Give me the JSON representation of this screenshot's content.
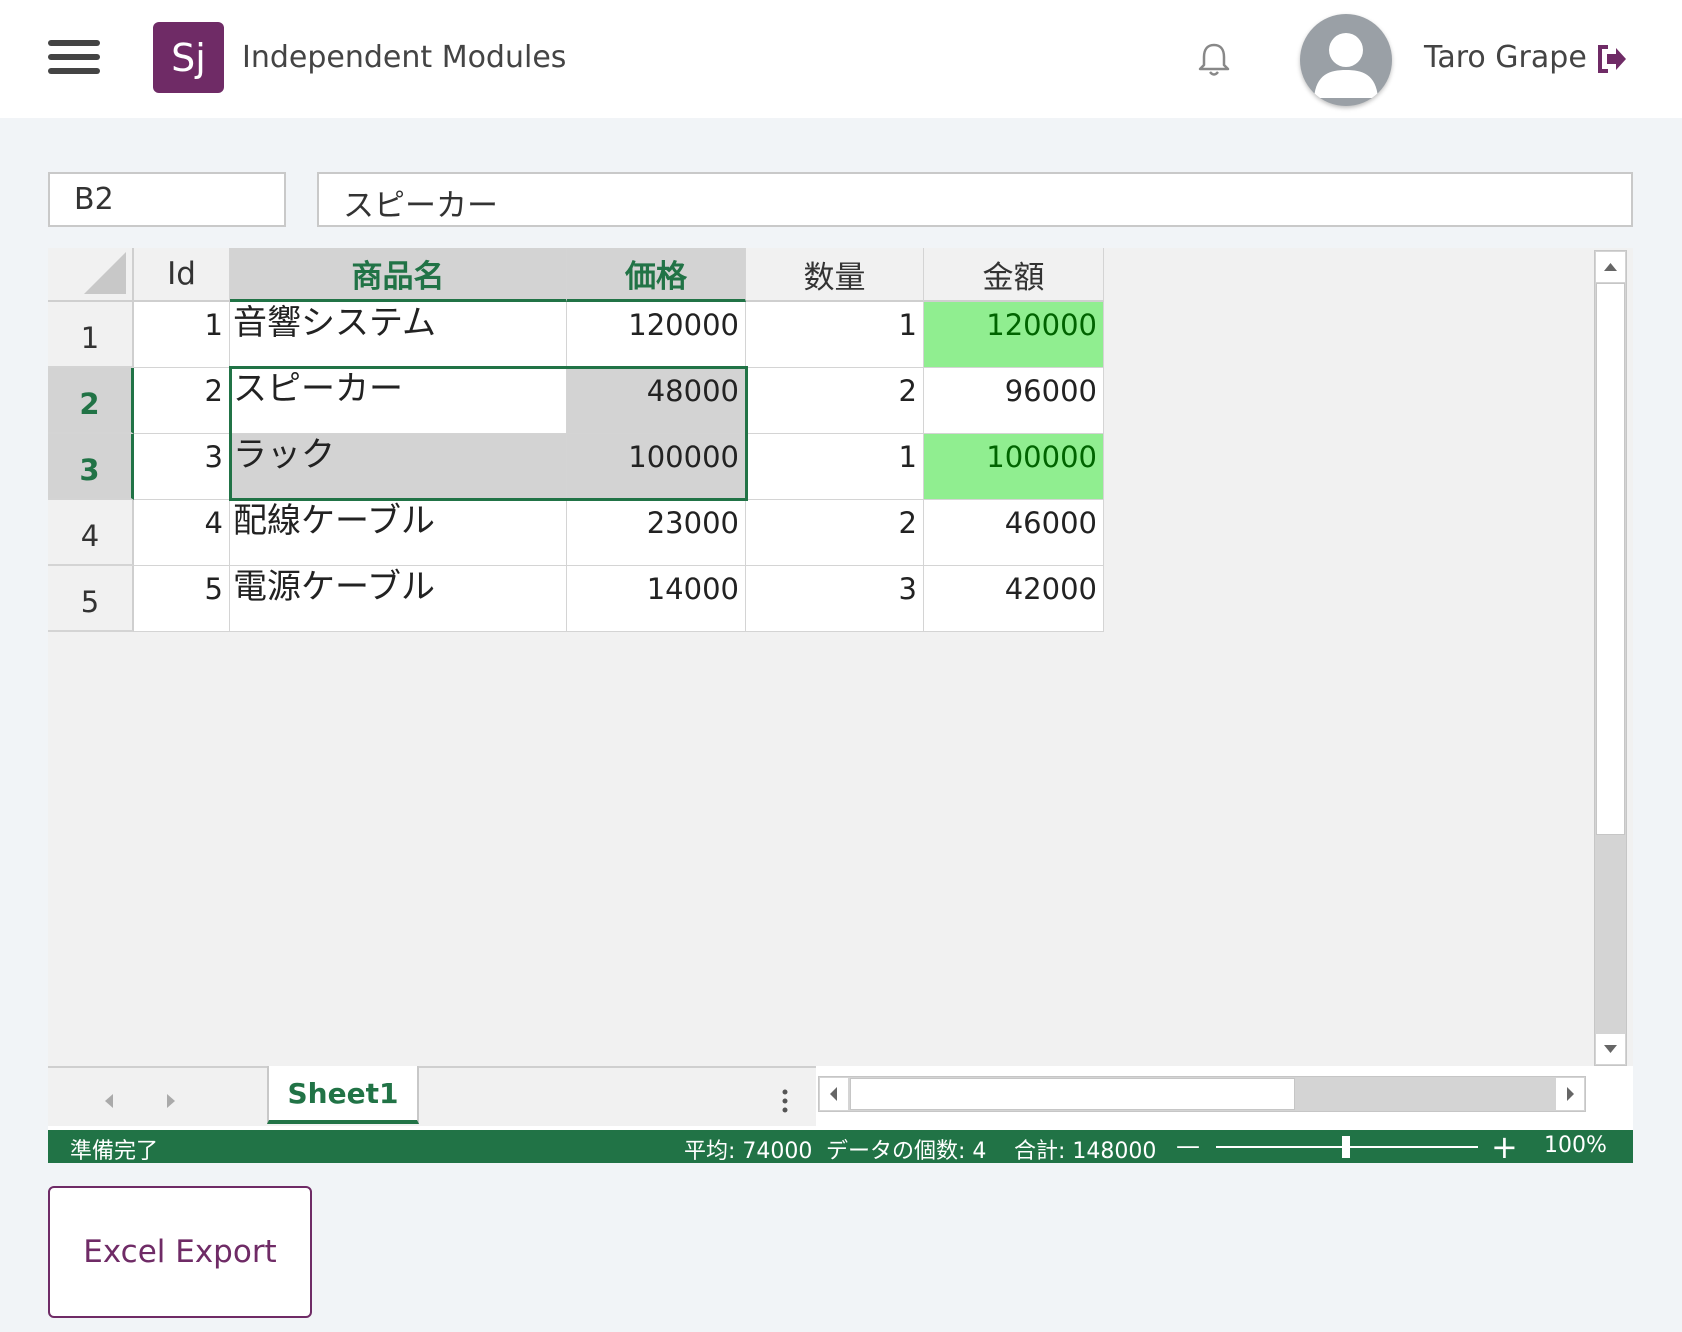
{
  "header": {
    "logo_text": "Sj",
    "app_title": "Independent Modules",
    "user_name": "Taro Grape"
  },
  "formula_bar": {
    "cell_ref": "B2",
    "value": "スピーカー"
  },
  "grid": {
    "columns": [
      "Id",
      "商品名",
      "価格",
      "数量",
      "金額"
    ],
    "row_numbers": [
      "1",
      "2",
      "3",
      "4",
      "5"
    ],
    "rows": [
      {
        "id": "1",
        "name": "音響システム",
        "price": "120000",
        "qty": "1",
        "amount": "120000"
      },
      {
        "id": "2",
        "name": "スピーカー",
        "price": "48000",
        "qty": "2",
        "amount": "96000"
      },
      {
        "id": "3",
        "name": "ラック",
        "price": "100000",
        "qty": "1",
        "amount": "100000"
      },
      {
        "id": "4",
        "name": "配線ケーブル",
        "price": "23000",
        "qty": "2",
        "amount": "46000"
      },
      {
        "id": "5",
        "name": "電源ケーブル",
        "price": "14000",
        "qty": "3",
        "amount": "42000"
      }
    ],
    "selected_range": "B2:C3",
    "highlight_color": "#90ee90",
    "accent_color": "#217346"
  },
  "sheet_tabs": {
    "active": "Sheet1"
  },
  "status_bar": {
    "ready": "準備完了",
    "average": "平均: 74000",
    "count": "データの個数: 4",
    "sum": "合計: 148000",
    "zoom": "100%"
  },
  "export": {
    "label": "Excel Export"
  },
  "icons": [
    "menu-icon",
    "bell-icon",
    "avatar-icon",
    "logout-icon",
    "corner-select-icon",
    "arrow-up-icon",
    "arrow-down-icon",
    "arrow-left-icon",
    "arrow-right-icon",
    "more-vert-icon"
  ]
}
